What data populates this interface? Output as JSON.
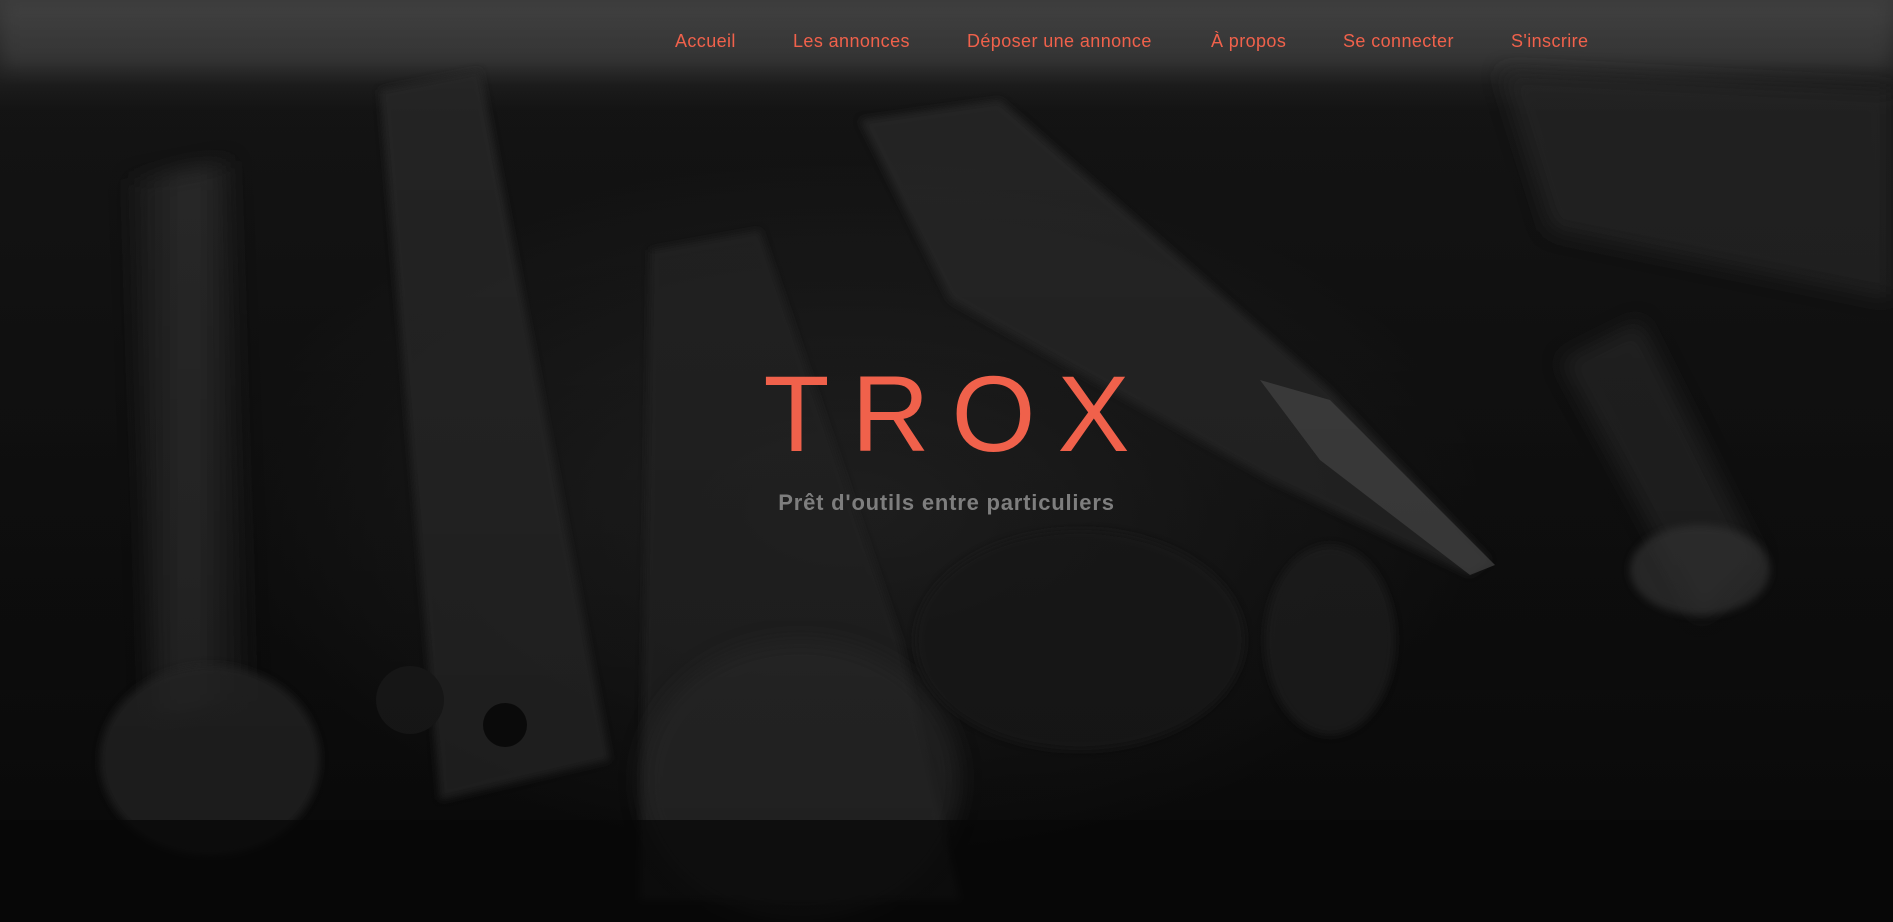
{
  "colors": {
    "accent": "#f0614b",
    "subtitle": "#7e7e7e"
  },
  "nav": {
    "items": [
      {
        "label": "Accueil"
      },
      {
        "label": "Les annonces"
      },
      {
        "label": "Déposer une annonce"
      },
      {
        "label": "À propos"
      },
      {
        "label": "Se connecter"
      },
      {
        "label": "S'inscrire"
      }
    ]
  },
  "hero": {
    "title": "TROX",
    "subtitle": "Prêt d'outils entre particuliers",
    "background_image": "blurred-hand-tools-photo"
  }
}
